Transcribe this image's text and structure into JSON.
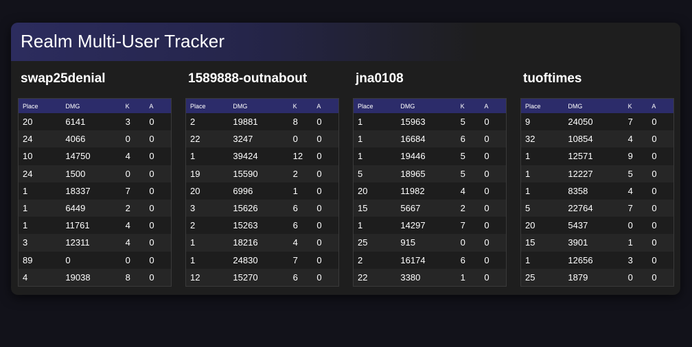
{
  "app": {
    "title": "Realm Multi-User Tracker"
  },
  "table_headers": [
    "Place",
    "DMG",
    "K",
    "A"
  ],
  "users": [
    {
      "name": "swap25denial",
      "rows": [
        [
          "20",
          "6141",
          "3",
          "0"
        ],
        [
          "24",
          "4066",
          "0",
          "0"
        ],
        [
          "10",
          "14750",
          "4",
          "0"
        ],
        [
          "24",
          "1500",
          "0",
          "0"
        ],
        [
          "1",
          "18337",
          "7",
          "0"
        ],
        [
          "1",
          "6449",
          "2",
          "0"
        ],
        [
          "1",
          "11761",
          "4",
          "0"
        ],
        [
          "3",
          "12311",
          "4",
          "0"
        ],
        [
          "89",
          "0",
          "0",
          "0"
        ],
        [
          "4",
          "19038",
          "8",
          "0"
        ]
      ]
    },
    {
      "name": "1589888-outnabout",
      "rows": [
        [
          "2",
          "19881",
          "8",
          "0"
        ],
        [
          "22",
          "3247",
          "0",
          "0"
        ],
        [
          "1",
          "39424",
          "12",
          "0"
        ],
        [
          "19",
          "15590",
          "2",
          "0"
        ],
        [
          "20",
          "6996",
          "1",
          "0"
        ],
        [
          "3",
          "15626",
          "6",
          "0"
        ],
        [
          "2",
          "15263",
          "6",
          "0"
        ],
        [
          "1",
          "18216",
          "4",
          "0"
        ],
        [
          "1",
          "24830",
          "7",
          "0"
        ],
        [
          "12",
          "15270",
          "6",
          "0"
        ]
      ]
    },
    {
      "name": "jna0108",
      "rows": [
        [
          "1",
          "15963",
          "5",
          "0"
        ],
        [
          "1",
          "16684",
          "6",
          "0"
        ],
        [
          "1",
          "19446",
          "5",
          "0"
        ],
        [
          "5",
          "18965",
          "5",
          "0"
        ],
        [
          "20",
          "11982",
          "4",
          "0"
        ],
        [
          "15",
          "5667",
          "2",
          "0"
        ],
        [
          "1",
          "14297",
          "7",
          "0"
        ],
        [
          "25",
          "915",
          "0",
          "0"
        ],
        [
          "2",
          "16174",
          "6",
          "0"
        ],
        [
          "22",
          "3380",
          "1",
          "0"
        ]
      ]
    },
    {
      "name": "tuoftimes",
      "rows": [
        [
          "9",
          "24050",
          "7",
          "0"
        ],
        [
          "32",
          "10854",
          "4",
          "0"
        ],
        [
          "1",
          "12571",
          "9",
          "0"
        ],
        [
          "1",
          "12227",
          "5",
          "0"
        ],
        [
          "1",
          "8358",
          "4",
          "0"
        ],
        [
          "5",
          "22764",
          "7",
          "0"
        ],
        [
          "20",
          "5437",
          "0",
          "0"
        ],
        [
          "15",
          "3901",
          "1",
          "0"
        ],
        [
          "1",
          "12656",
          "3",
          "0"
        ],
        [
          "25",
          "1879",
          "0",
          "0"
        ]
      ]
    }
  ]
}
